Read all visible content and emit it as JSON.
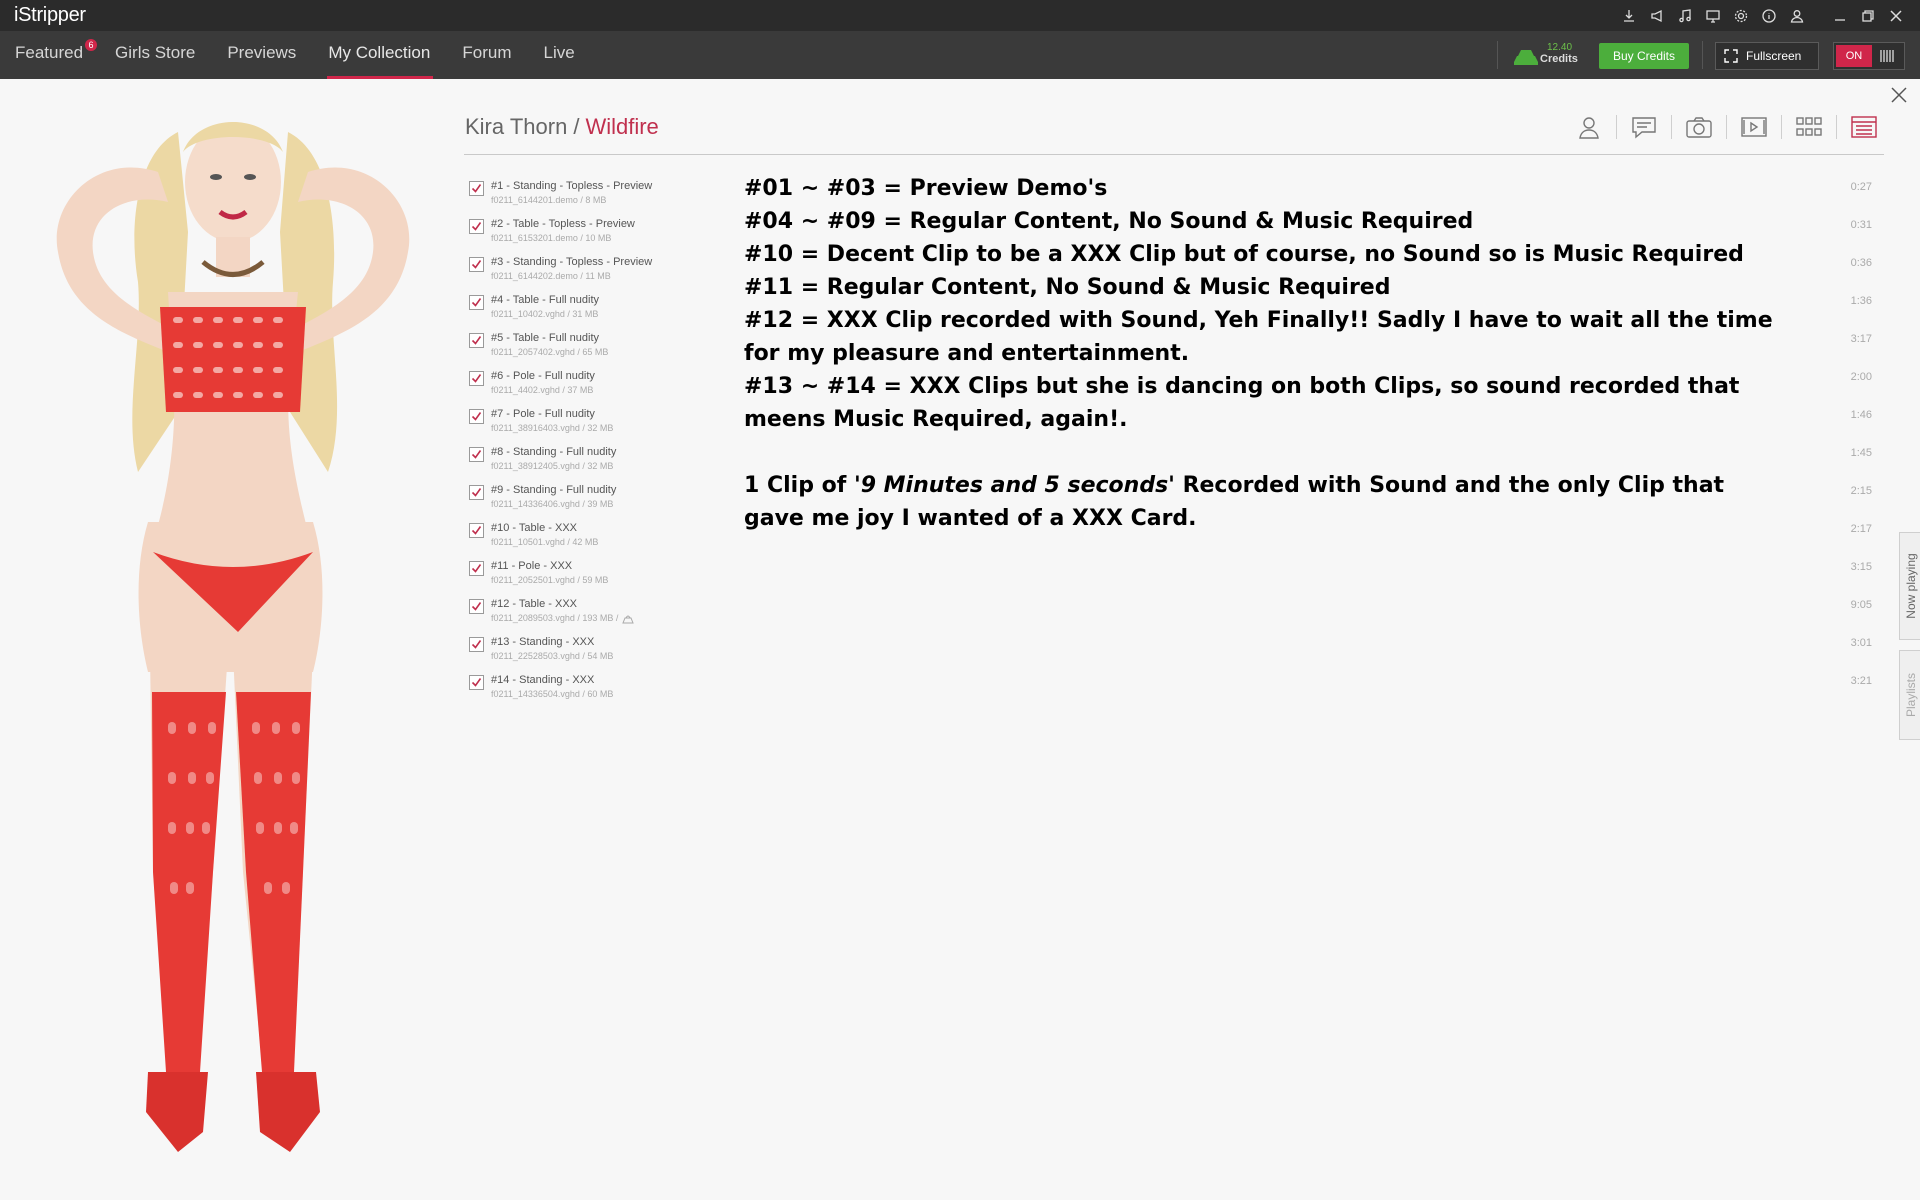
{
  "app": {
    "title": "iStripper"
  },
  "titlebar_icons": [
    "download-icon",
    "announce-icon",
    "music-icon",
    "monitor-icon",
    "settings-icon",
    "info-icon",
    "user-icon",
    "minimize-icon",
    "restore-icon",
    "close-icon"
  ],
  "nav": {
    "tabs": [
      {
        "label": "Featured",
        "badge": "6"
      },
      {
        "label": "Girls Store"
      },
      {
        "label": "Previews"
      },
      {
        "label": "My Collection",
        "active": true
      },
      {
        "label": "Forum"
      },
      {
        "label": "Live"
      }
    ],
    "credits_amount": "12.40",
    "credits_label": "Credits",
    "buy_credits": "Buy Credits",
    "fullscreen": "Fullscreen",
    "toggle_on": "ON"
  },
  "card": {
    "model": "Kira Thorn",
    "separator": "/",
    "title": "Wildfire"
  },
  "header_icons": [
    "profile-icon",
    "comments-icon",
    "camera-icon",
    "video-icon",
    "grid-icon",
    "calendar-icon"
  ],
  "clips": [
    {
      "title": "#1 - Standing - Topless - Preview",
      "file": "f0211_6144201.demo / 8 MB",
      "duration": "0:27"
    },
    {
      "title": "#2 - Table - Topless - Preview",
      "file": "f0211_6153201.demo / 10 MB",
      "duration": "0:31"
    },
    {
      "title": "#3 - Standing - Topless - Preview",
      "file": "f0211_6144202.demo / 11 MB",
      "duration": "0:36"
    },
    {
      "title": "#4 - Table - Full nudity",
      "file": "f0211_10402.vghd / 31 MB",
      "duration": "1:36"
    },
    {
      "title": "#5 - Table - Full nudity",
      "file": "f0211_2057402.vghd / 65 MB",
      "duration": "3:17"
    },
    {
      "title": "#6 - Pole - Full nudity",
      "file": "f0211_4402.vghd / 37 MB",
      "duration": "2:00"
    },
    {
      "title": "#7 - Pole - Full nudity",
      "file": "f0211_38916403.vghd / 32 MB",
      "duration": "1:46"
    },
    {
      "title": "#8 - Standing - Full nudity",
      "file": "f0211_38912405.vghd / 32 MB",
      "duration": "1:45"
    },
    {
      "title": "#9 - Standing - Full nudity",
      "file": "f0211_14336406.vghd / 39 MB",
      "duration": "2:15"
    },
    {
      "title": "#10 - Table - XXX",
      "file": "f0211_10501.vghd / 42 MB",
      "duration": "2:17"
    },
    {
      "title": "#11 - Pole - XXX",
      "file": "f0211_2052501.vghd / 59 MB",
      "duration": "3:15"
    },
    {
      "title": "#12 - Table - XXX",
      "file": "f0211_2089503.vghd / 193 MB /",
      "duration": "9:05",
      "sound": true
    },
    {
      "title": "#13 - Standing - XXX",
      "file": "f0211_22528503.vghd / 54 MB",
      "duration": "3:01"
    },
    {
      "title": "#14 - Standing - XXX",
      "file": "f0211_14336504.vghd / 60 MB",
      "duration": "3:21"
    }
  ],
  "note": {
    "line1": "#01 ~ #03 = Preview Demo's",
    "line2": "#04 ~ #09 = Regular Content, No Sound & Music Required",
    "line3": "#10 = Decent Clip to be a XXX Clip but of course, no Sound so is Music Required",
    "line4": "#11 = Regular Content, No Sound & Music Required",
    "line5": "#12 = XXX Clip recorded with Sound, Yeh Finally!! Sadly I have to wait all the time for my pleasure and entertainment.",
    "line6": "#13 ~ #14 = XXX Clips but she is dancing on both Clips, so sound recorded that meens Music Required, again!.",
    "line7_a": "1 Clip of '",
    "line7_b": "9 Minutes and 5 seconds'",
    "line7_c": " Recorded with Sound and the only Clip that gave me joy I wanted of a XXX Card."
  },
  "side_tabs": {
    "now_playing": "Now playing",
    "playlists": "Playlists"
  },
  "colors": {
    "accent": "#d0264a",
    "credits_green": "#4cae3c",
    "titlebar": "#2b2b2b",
    "navbar": "#3a3a3a"
  }
}
